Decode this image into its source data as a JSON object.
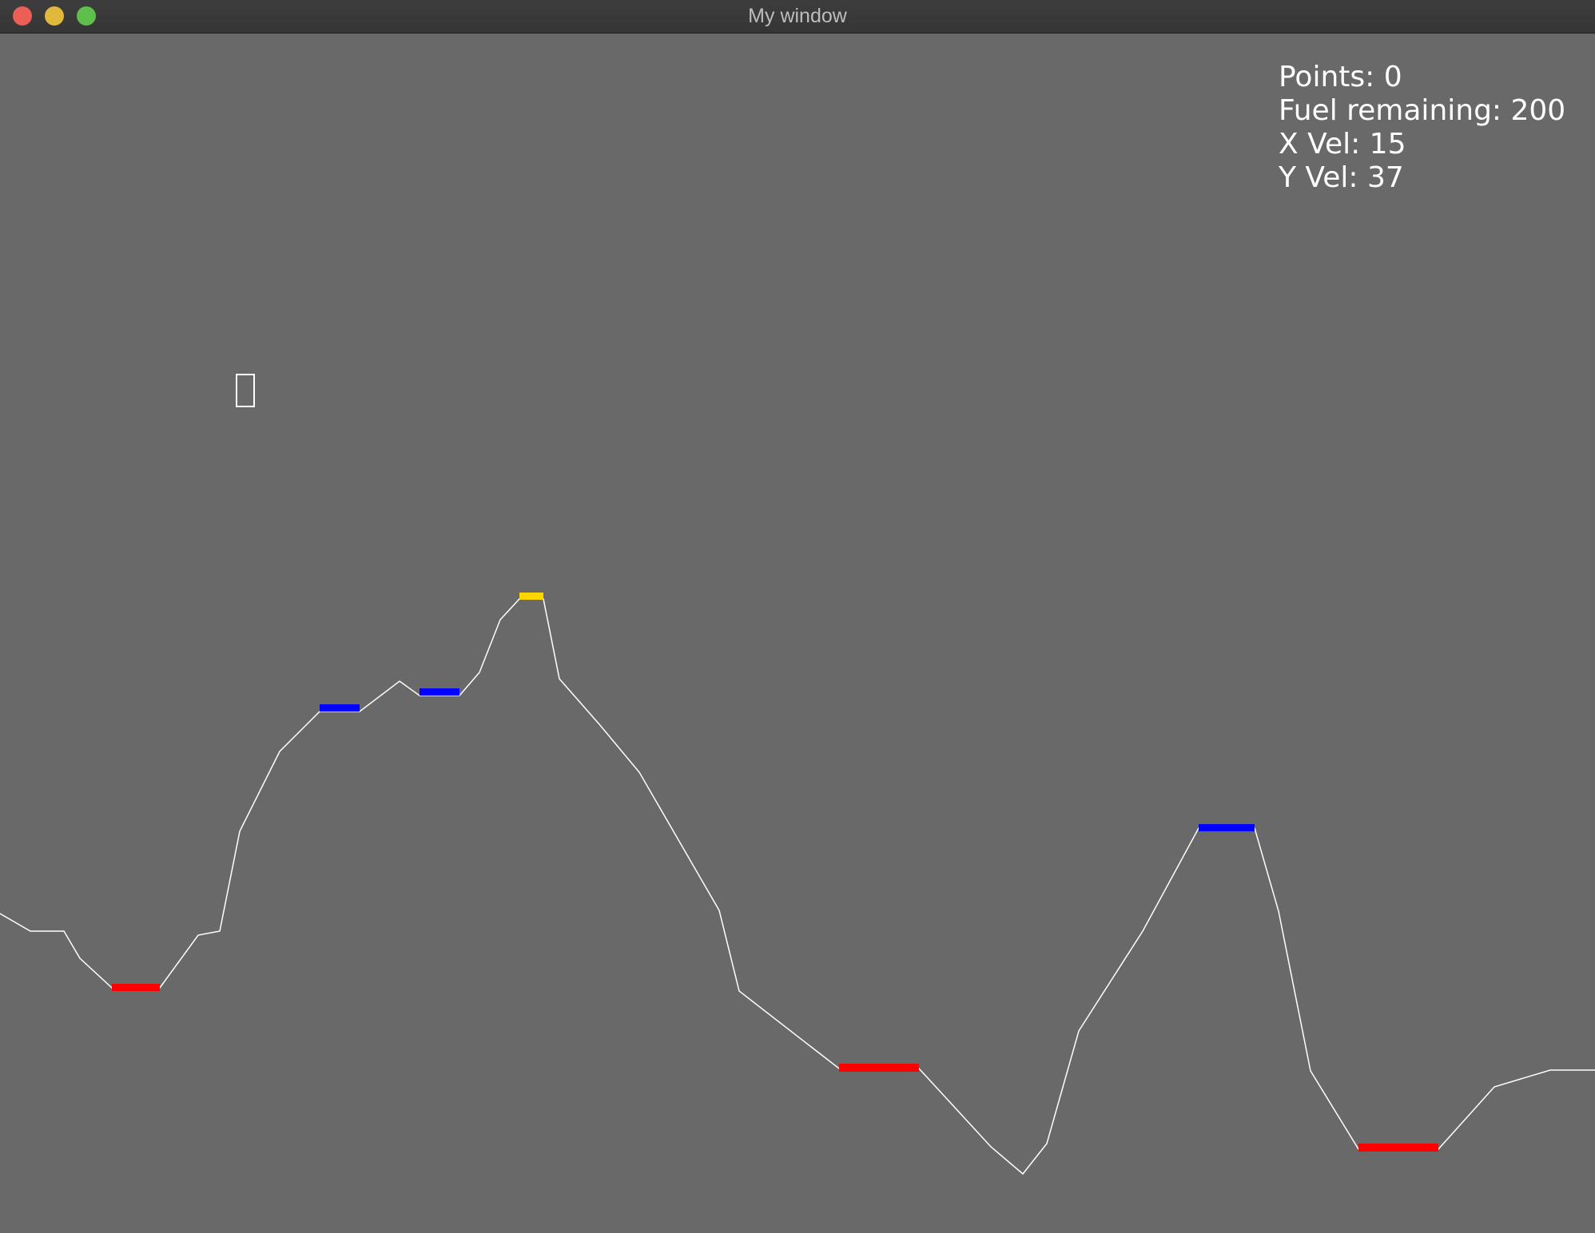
{
  "window": {
    "title": "My window"
  },
  "hud": {
    "points": "Points: 0",
    "fuel": "Fuel remaining: 200",
    "x_vel": "X Vel: 15",
    "y_vel": "Y Vel: 37"
  },
  "colors": {
    "background": "#696969",
    "terrain": "#ffffff",
    "pad_red": "#ff0000",
    "pad_blue": "#0000ff",
    "pad_yellow": "#ffd700",
    "lander": "#ffffff"
  },
  "game": {
    "lander_icon": "lander-outline",
    "landing_pads": [
      {
        "color": "red"
      },
      {
        "color": "blue"
      },
      {
        "color": "blue"
      },
      {
        "color": "yellow"
      },
      {
        "color": "red"
      },
      {
        "color": "blue"
      },
      {
        "color": "red"
      }
    ]
  }
}
